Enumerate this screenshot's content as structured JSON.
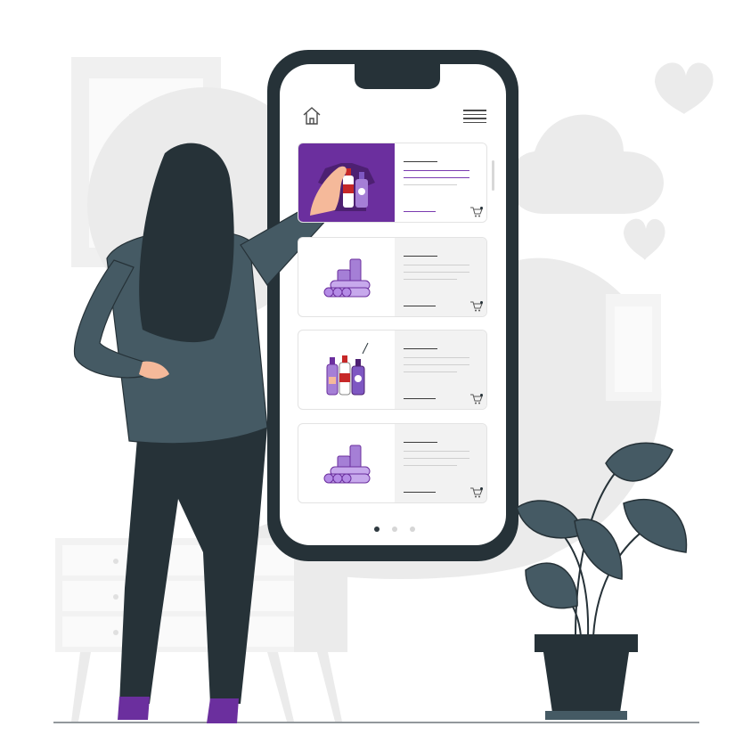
{
  "colors": {
    "accent_purple": "#6b2f9e",
    "light_purple": "#a57fd6",
    "phone_frame": "#263238",
    "character_dark": "#263238",
    "jacket": "#455a64",
    "skin": "#f5b99a",
    "background_gray": "#ebebeb"
  },
  "phone": {
    "top_bar": {
      "home_icon": "home-icon",
      "menu_icon": "hamburger-menu-icon"
    },
    "products": [
      {
        "state": "selected",
        "thumbnail": "bottles-on-shirt",
        "has_cart": true
      },
      {
        "state": "default",
        "thumbnail": "cylinder-stack",
        "has_cart": true
      },
      {
        "state": "default",
        "thumbnail": "three-bottles",
        "has_cart": true
      },
      {
        "state": "default",
        "thumbnail": "cylinder-stack",
        "has_cart": true
      }
    ],
    "pagination": {
      "pages": 3,
      "current": 1
    }
  }
}
